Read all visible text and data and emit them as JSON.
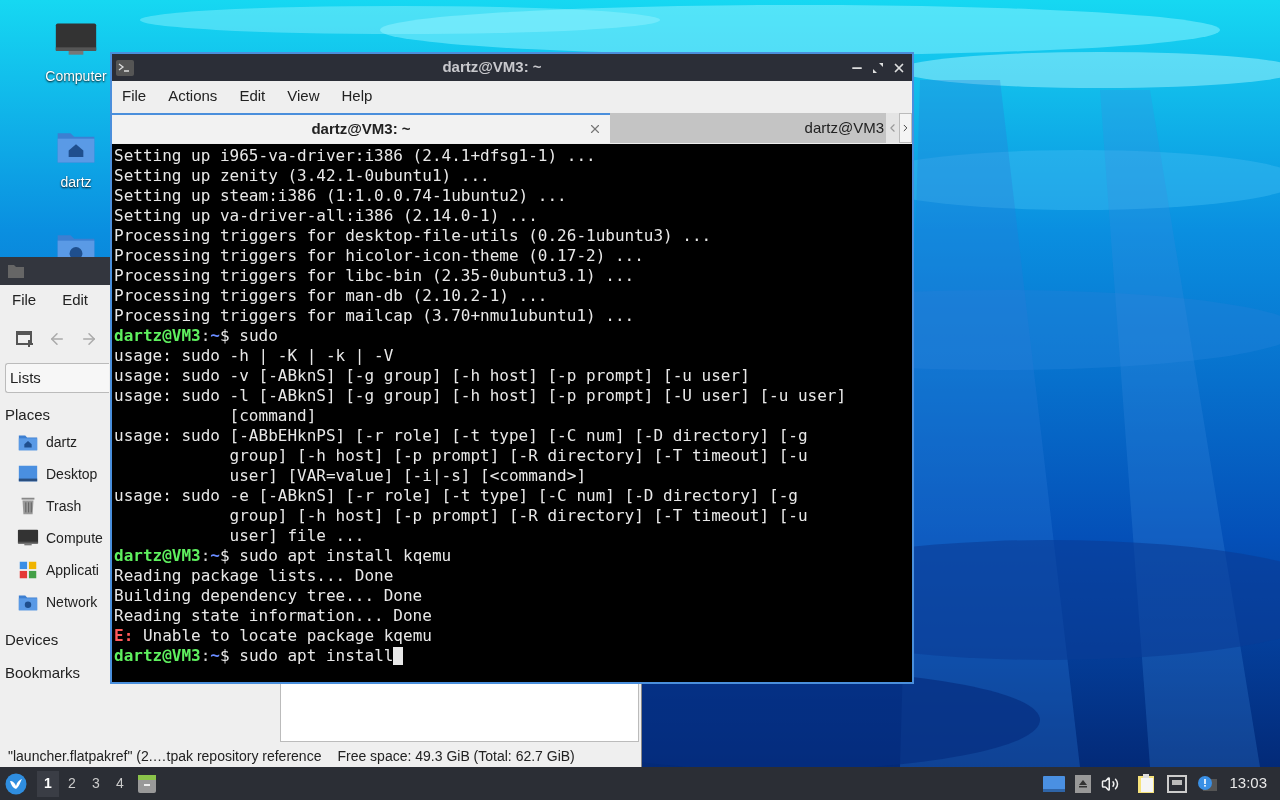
{
  "desktop_icons": [
    {
      "label": "Computer",
      "kind": "computer"
    },
    {
      "label": "dartz",
      "kind": "home"
    },
    {
      "kind": "network"
    }
  ],
  "file_manager": {
    "menu": [
      "File",
      "Edit"
    ],
    "view_selector": "Lists",
    "sections": [
      {
        "title": "Places",
        "items": [
          {
            "label": "dartz",
            "kind": "home"
          },
          {
            "label": "Desktop",
            "kind": "desktop"
          },
          {
            "label": "Trash",
            "kind": "trash"
          },
          {
            "label": "Compute",
            "kind": "computer"
          },
          {
            "label": "Applicati",
            "kind": "apps"
          },
          {
            "label": "Network",
            "kind": "network"
          }
        ]
      },
      {
        "title": "Devices"
      },
      {
        "title": "Bookmarks"
      }
    ],
    "status_bar": {
      "selection": "\"launcher.flatpakref\" (2.…tpak repository reference",
      "free_space": "Free space: 49.3 GiB (Total: 62.7 GiB)"
    }
  },
  "terminal": {
    "title": "dartz@VM3: ~",
    "menu": [
      "File",
      "Actions",
      "Edit",
      "View",
      "Help"
    ],
    "tabs": [
      {
        "label": "dartz@VM3: ~",
        "selected": true
      },
      {
        "label": "dartz@VM3",
        "selected": false
      }
    ],
    "lines": [
      {
        "kind": "output",
        "text": "Setting up i965-va-driver:i386 (2.4.1+dfsg1-1) ..."
      },
      {
        "kind": "output",
        "text": "Setting up zenity (3.42.1-0ubuntu1) ..."
      },
      {
        "kind": "output",
        "text": "Setting up steam:i386 (1:1.0.0.74-1ubuntu2) ..."
      },
      {
        "kind": "output",
        "text": "Setting up va-driver-all:i386 (2.14.0-1) ..."
      },
      {
        "kind": "output",
        "text": "Processing triggers for desktop-file-utils (0.26-1ubuntu3) ..."
      },
      {
        "kind": "output",
        "text": "Processing triggers for hicolor-icon-theme (0.17-2) ..."
      },
      {
        "kind": "output",
        "text": "Processing triggers for libc-bin (2.35-0ubuntu3.1) ..."
      },
      {
        "kind": "output",
        "text": "Processing triggers for man-db (2.10.2-1) ..."
      },
      {
        "kind": "output",
        "text": "Processing triggers for mailcap (3.70+nmu1ubuntu1) ..."
      },
      {
        "kind": "prompt",
        "user": "dartz@VM3",
        "sep": ":",
        "path": "~",
        "symbol": "$",
        "command": "sudo",
        "cursor": false
      },
      {
        "kind": "output",
        "text": "usage: sudo -h | -K | -k | -V"
      },
      {
        "kind": "output",
        "text": "usage: sudo -v [-ABknS] [-g group] [-h host] [-p prompt] [-u user]"
      },
      {
        "kind": "output",
        "text": "usage: sudo -l [-ABknS] [-g group] [-h host] [-p prompt] [-U user] [-u user]"
      },
      {
        "kind": "output",
        "text": "            [command]"
      },
      {
        "kind": "output",
        "text": "usage: sudo [-ABbEHknPS] [-r role] [-t type] [-C num] [-D directory] [-g"
      },
      {
        "kind": "output",
        "text": "            group] [-h host] [-p prompt] [-R directory] [-T timeout] [-u"
      },
      {
        "kind": "output",
        "text": "            user] [VAR=value] [-i|-s] [<command>]"
      },
      {
        "kind": "output",
        "text": "usage: sudo -e [-ABknS] [-r role] [-t type] [-C num] [-D directory] [-g"
      },
      {
        "kind": "output",
        "text": "            group] [-h host] [-p prompt] [-R directory] [-T timeout] [-u"
      },
      {
        "kind": "output",
        "text": "            user] file ..."
      },
      {
        "kind": "prompt",
        "user": "dartz@VM3",
        "sep": ":",
        "path": "~",
        "symbol": "$",
        "command": "sudo apt install kqemu",
        "cursor": false
      },
      {
        "kind": "output",
        "text": "Reading package lists... Done"
      },
      {
        "kind": "output",
        "text": "Building dependency tree... Done"
      },
      {
        "kind": "output",
        "text": "Reading state information... Done"
      },
      {
        "kind": "error",
        "tag": "E:",
        "text": "Unable to locate package kqemu"
      },
      {
        "kind": "prompt",
        "user": "dartz@VM3",
        "sep": ":",
        "path": "~",
        "symbol": "$",
        "command": "sudo apt install",
        "cursor": true
      }
    ]
  },
  "taskbar": {
    "workspaces": [
      {
        "label": "1",
        "selected": true
      },
      {
        "label": "2",
        "selected": false
      },
      {
        "label": "3",
        "selected": false
      },
      {
        "label": "4",
        "selected": false
      }
    ],
    "clock": "13:03"
  }
}
